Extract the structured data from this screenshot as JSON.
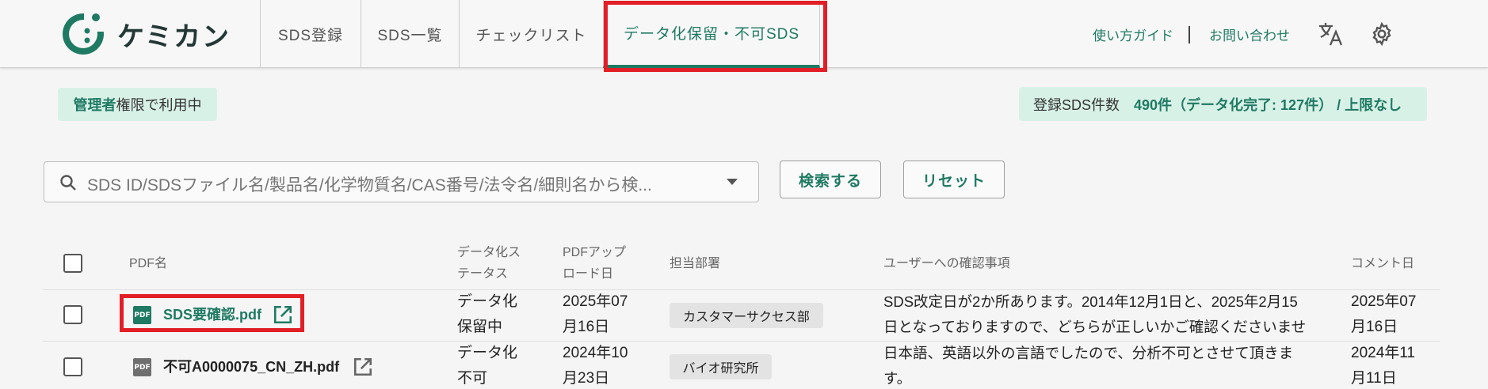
{
  "header": {
    "logo_text": "ケミカン",
    "tabs": [
      {
        "label": "SDS登録"
      },
      {
        "label": "SDS一覧"
      },
      {
        "label": "チェックリスト"
      },
      {
        "label": "データ化保留・不可SDS"
      }
    ],
    "active_tab": "データ化保留・不可SDS",
    "guide_link": "使い方ガイド",
    "contact_link": "お問い合わせ",
    "translate_icon": "translate-icon",
    "settings_icon": "gear-icon"
  },
  "admin_badge": {
    "strong": "管理者",
    "rest": "権限で利用中"
  },
  "count_badge": {
    "label": "登録SDS件数",
    "value": "490件（データ化完了: 127件） / 上限なし"
  },
  "search": {
    "placeholder": "SDS ID/SDSファイル名/製品名/化学物質名/CAS番号/法令名/細則名から検...",
    "search_button": "検索する",
    "reset_button": "リセット"
  },
  "table": {
    "headers": {
      "pdf_name": "PDF名",
      "status_line1": "データ化ス",
      "status_line2": "テータス",
      "upload_line1": "PDFアップ",
      "upload_line2": "ロード日",
      "department": "担当部署",
      "user_check": "ユーザーへの確認事項",
      "comment_date": "コメント日"
    },
    "rows": [
      {
        "pdf_name": "SDS要確認.pdf",
        "status_line1": "データ化",
        "status_line2": "保留中",
        "upload_line1": "2025年07",
        "upload_line2": "月16日",
        "department": "カスタマーサクセス部",
        "check_line1": "SDS改定日が2か所あります。2014年12月1日と、2025年2月15",
        "check_line2": "日となっておりますので、どちらが正しいかご確認くださいませ",
        "comment_line1": "2025年07",
        "comment_line2": "月16日"
      },
      {
        "pdf_name": "不可A0000075_CN_ZH.pdf",
        "status_line1": "データ化",
        "status_line2": "不可",
        "upload_line1": "2024年10",
        "upload_line2": "月23日",
        "department": "バイオ研究所",
        "check_line1": "日本語、英語以外の言語でしたので、分析不可とさせて頂きま",
        "check_line2": "す。",
        "comment_line1": "2024年11",
        "comment_line2": "月11日"
      }
    ]
  },
  "colors": {
    "brand": "#1f7a63",
    "highlight": "#e21f26",
    "badge_bg": "#d8f1e7"
  }
}
